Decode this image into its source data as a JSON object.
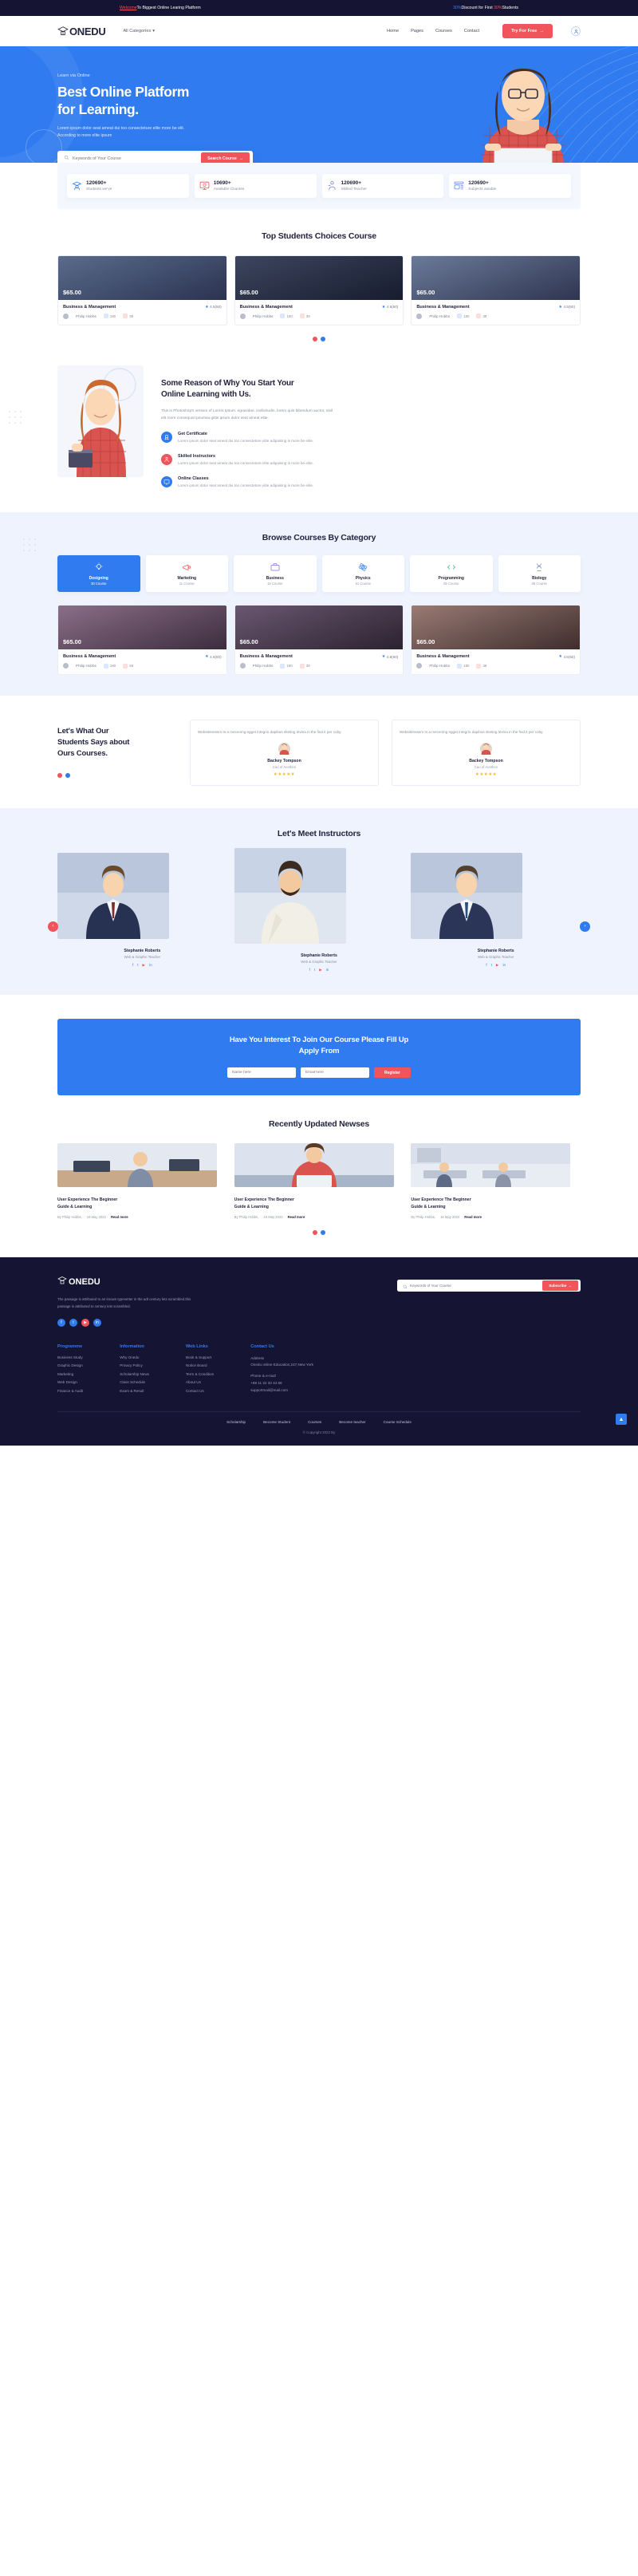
{
  "topbar": {
    "welcome": "Welcome",
    "tagline": "To Biggest Online Learing Platform",
    "discount_pct": "30%",
    "discount_mid": "Discount for First ",
    "discount_pct2": "30%",
    "discount_end": "Students"
  },
  "nav": {
    "logo": "ONEDU",
    "categories": "All Categories",
    "links": [
      "Home",
      "Pages",
      "Courses",
      "Contact"
    ],
    "cta": "Try For Free"
  },
  "hero": {
    "kicker": "Learn via Online",
    "title_line1": "Best Online Platform",
    "title_line2": "for Learning.",
    "paragraph_line1": "Lorem ipsum dolor seat ameat dui too consecteture elite more be elit.",
    "paragraph_line2": "According to more elite ipsum",
    "search_placeholder": "Keywords of Your Course",
    "search_button": "Search Course"
  },
  "stats": [
    {
      "number": "120690+",
      "label": "Students we've",
      "icon": "graduate-icon",
      "color": "#2f7bef"
    },
    {
      "number": "10690+",
      "label": "Available Courses",
      "icon": "monitor-icon",
      "color": "#f2545b"
    },
    {
      "number": "120690+",
      "label": "Skilled Teacher",
      "icon": "teacher-icon",
      "color": "#2f7bef"
    },
    {
      "number": "120690+",
      "label": "Subjects aviable",
      "icon": "list-icon",
      "color": "#2f7bef"
    }
  ],
  "top_courses": {
    "title": "Top Students Choices Course",
    "cards": [
      {
        "price": "$65.00",
        "name": "Business & Management",
        "rating": "4.5(50)",
        "author": "Philip Hobbs",
        "views": "180",
        "comments": "38"
      },
      {
        "price": "$65.00",
        "name": "Business & Management",
        "rating": "4.5(50)",
        "author": "Philip Hobbs",
        "views": "180",
        "comments": "38"
      },
      {
        "price": "$65.00",
        "name": "Business & Management",
        "rating": "4.5(50)",
        "author": "Philip Hobbs",
        "views": "180",
        "comments": "38"
      }
    ]
  },
  "reason": {
    "title_line1": "Some Reason of Why You Start Your",
    "title_line2": "Online Learning with Us.",
    "paragraph": "This is Photoshop's version of Lorem Ipsum. egravidae. isollicitudin, lorem quis bibendum auctor, nisil elit more consequat ipsumsa gittis ipsum dolor seat ameat elite.",
    "features": [
      {
        "title": "Get Certificate",
        "text": "Lorem ipsum dolor seat ameat dui too consecteture elite adipaising is more be elite.",
        "color": "blue",
        "icon": "certificate-icon"
      },
      {
        "title": "Skilled Instructors",
        "text": "Lorem ipsum dolor seat ameat dui too consecteture elite adipaising is more be elite.",
        "color": "red",
        "icon": "instructor-icon"
      },
      {
        "title": "Online Classes",
        "text": "Lorem ipsum dolor seat ameat dui too consecteture elite adipaising is more be elite.",
        "color": "blue",
        "icon": "monitor-icon"
      }
    ]
  },
  "category": {
    "title": "Browse Courses By Category",
    "items": [
      {
        "name": "Designing",
        "count": "30 Course",
        "icon": "lamp-icon",
        "active": true
      },
      {
        "name": "Marketing",
        "count": "11 Course",
        "icon": "megaphone-icon",
        "active": false
      },
      {
        "name": "Business",
        "count": "19 Course",
        "icon": "briefcase-icon",
        "active": false
      },
      {
        "name": "Physics",
        "count": "61 Course",
        "icon": "atom-icon",
        "active": false
      },
      {
        "name": "Programming",
        "count": "09 Course",
        "icon": "code-icon",
        "active": false
      },
      {
        "name": "Biology",
        "count": "08 Course",
        "icon": "dna-icon",
        "active": false
      }
    ],
    "cards": [
      {
        "price": "$65.00",
        "name": "Business & Management",
        "rating": "4.5(50)",
        "author": "Philip Hobbs",
        "views": "180",
        "comments": "38"
      },
      {
        "price": "$65.00",
        "name": "Business & Management",
        "rating": "4.5(50)",
        "author": "Philip Hobbs",
        "views": "180",
        "comments": "38"
      },
      {
        "price": "$65.00",
        "name": "Business & Management",
        "rating": "4.5(50)",
        "author": "Philip Hobbs",
        "views": "180",
        "comments": "38"
      }
    ]
  },
  "testimonial": {
    "title_line1": "Let's What Our",
    "title_line2": "Students Says about",
    "title_line3": "Ours Courses.",
    "cards": [
      {
        "quote": "Websitenessm In a mecening egget integrio dapibus sketing levina in the find it per coby.",
        "name": "Backey Tompson",
        "role": "Cao of Aesthen",
        "stars": "★★★★★"
      },
      {
        "quote": "Websitenessm In a mecening egget integrio dapibus sketing levina in the find it per coby.",
        "name": "Backey Tompson",
        "role": "Cao of Aesthen",
        "stars": "★★★★★"
      }
    ]
  },
  "instructors": {
    "title": "Let's Meet Instructors",
    "cards": [
      {
        "name": "Stephanie Roberts",
        "role": "Web & Graphic Teacher"
      },
      {
        "name": "Stephanie Roberts",
        "role": "Web & Graphic Teacher"
      },
      {
        "name": "Stephanie Roberts",
        "role": "Web & Graphic Teacher"
      }
    ]
  },
  "cta": {
    "title_line1": "Have You Interest To Join Our Course Please Fill Up",
    "title_line2": "Apply From",
    "name_placeholder": "Name here",
    "email_placeholder": "Email here",
    "button": "Register"
  },
  "news": {
    "title": "Recently Updated Newses",
    "cards": [
      {
        "title_line1": "User Experience The Beginner",
        "title_line2": "Guide & Learning",
        "author": "By Philip Hobbs,",
        "date": "16 May 2022",
        "readmore": "Read more"
      },
      {
        "title_line1": "User Experience The Beginner",
        "title_line2": "Guide & Learning",
        "author": "By Philip Hobbs,",
        "date": "16 May 2022",
        "readmore": "Read more"
      },
      {
        "title_line1": "User Experience The Beginner",
        "title_line2": "Guide & Learning",
        "author": "By Philip Hobbs,",
        "date": "16 May 2022",
        "readmore": "Read more"
      }
    ]
  },
  "footer": {
    "logo": "ONEDU",
    "about": "The passage is attributed to an known typesetter in the adt century lets scrambled.this passage is attributed to century lets scrambled.",
    "search_placeholder": "Keywords of Your Course",
    "subscribe_button": "Subscribe",
    "socials": [
      "f",
      "t",
      "y",
      "in"
    ],
    "columns": [
      {
        "title": "Programme",
        "links": [
          "Business Study",
          "Graphic Design",
          "Marketing",
          "Web Design",
          "Finance & Audit"
        ]
      },
      {
        "title": "Information",
        "links": [
          "Why Onedu",
          "Privacy Policy",
          "Scholarship News",
          "Class Schedule",
          "Exam & Result"
        ]
      },
      {
        "title": "Web Links",
        "links": [
          "Book & Support",
          "Notice Board",
          "Term & Condition",
          "About Us",
          "Contact Us"
        ]
      }
    ],
    "contact": {
      "title": "Contact Us",
      "address_label": "Address",
      "address": "Onedu online Education,247,New York",
      "phone_label": "Phone & e-mail",
      "phone": "+88 11 22 33 44 66",
      "email": "supportmail@mail.com"
    },
    "bottom_links": [
      "Scholarship",
      "Become Student",
      "Courses",
      "Become teacher",
      "Course Schedule"
    ],
    "copyright": "© Copyright 2022 By"
  },
  "colors": {
    "brand_blue": "#2f7bef",
    "accent_red": "#f2545b",
    "dark": "#151432",
    "light_blue_bg": "#eef3fd"
  }
}
